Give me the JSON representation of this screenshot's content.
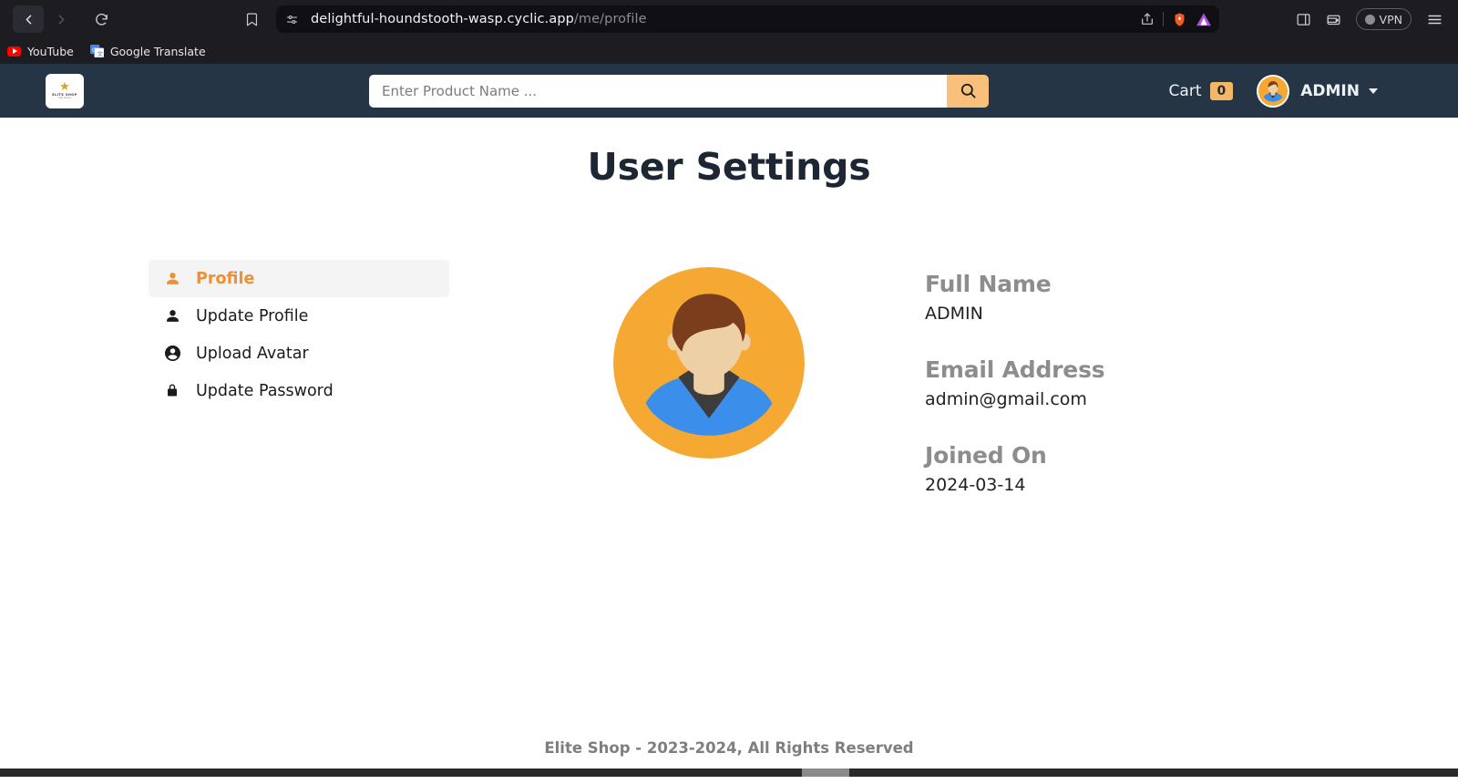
{
  "browser": {
    "back_icon": "chevron-left-icon",
    "forward_icon": "chevron-right-icon",
    "reload_icon": "reload-icon",
    "bookmark_icon": "bookmark-icon",
    "url_prefix_icon": "site-settings-icon",
    "url_domain": "delightful-houndstooth-wasp.cyclic.app",
    "url_path": "/me/profile",
    "share_icon": "share-icon",
    "brave_shield_icon": "brave-lion-icon",
    "extension_icon": "triangle-extension-icon",
    "sidebar_icon": "sidebar-panel-icon",
    "wallet_icon": "wallet-icon",
    "vpn_label": "VPN",
    "menu_icon": "hamburger-menu-icon",
    "bookmarks": [
      {
        "label": "YouTube",
        "icon": "youtube-icon"
      },
      {
        "label": "Google Translate",
        "icon": "google-translate-icon"
      }
    ]
  },
  "navbar": {
    "logo_star": "★",
    "logo_text": "ELITE SHOP",
    "logo_sub": "best quality",
    "search_placeholder": "Enter Product Name ...",
    "search_value": "",
    "search_icon": "search-icon",
    "cart_label": "Cart",
    "cart_count": "0",
    "user_name": "ADMIN",
    "user_avatar_icon": "user-avatar-icon",
    "caret_icon": "caret-down-icon",
    "bg_color": "#263545",
    "accent_color": "#f3b867"
  },
  "page": {
    "title": "User Settings",
    "footer": "Elite Shop - 2023-2024, All Rights Reserved"
  },
  "sidebar": {
    "items": [
      {
        "label": "Profile",
        "icon": "person-fill-icon",
        "active": true
      },
      {
        "label": "Update Profile",
        "icon": "person-fill-icon",
        "active": false
      },
      {
        "label": "Upload Avatar",
        "icon": "person-circle-icon",
        "active": false
      },
      {
        "label": "Update Password",
        "icon": "lock-fill-icon",
        "active": false
      }
    ],
    "active_color": "#ef9033",
    "active_bg": "#f4f4f4"
  },
  "profile": {
    "avatar_icon": "user-avatar-large-icon",
    "fields": [
      {
        "label": "Full Name",
        "value": "ADMIN"
      },
      {
        "label": "Email Address",
        "value": "admin@gmail.com"
      },
      {
        "label": "Joined On",
        "value": "2024-03-14"
      }
    ]
  }
}
